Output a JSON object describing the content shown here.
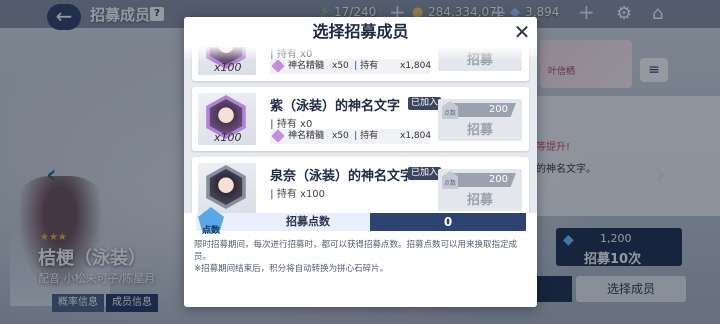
{
  "header": {
    "title": "招募成员",
    "info_badge": "?",
    "stamina": "17/240",
    "coins": "284,334,072",
    "gems": "3,894"
  },
  "background": {
    "char_name": "桔梗（泳装）",
    "char_cv": "配音 小松未可子/陈星月",
    "tabs": [
      "概率信息",
      "成员信息"
    ],
    "right_text_red": "等提升!",
    "right_text": "的神名文字。",
    "banner_text": "叶信栖",
    "recruit_cost": "1,200",
    "recruit_label": "招募10次",
    "select_member_label": "选择成员"
  },
  "modal": {
    "title": "选择招募成员",
    "close_label": "✕",
    "cards": [
      {
        "name": "",
        "joined_tag": "",
        "held_label": "持有",
        "held_value": "x0",
        "owned_qty": "x100",
        "material_name": "神名精髓",
        "material_mult": "x50",
        "material_held_label": "持有",
        "material_held_value": "x1,804",
        "points": "",
        "button_label": "招募"
      },
      {
        "name": "紫（泳装）的神名文字",
        "joined_tag": "已加入",
        "held_label": "持有",
        "held_value": "x0",
        "owned_qty": "x100",
        "material_name": "神名精髓",
        "material_mult": "x50",
        "material_held_label": "持有",
        "material_held_value": "x1,804",
        "points": "200",
        "points_badge": "点数",
        "button_label": "招募"
      },
      {
        "name": "泉奈（泳装）的神名文字",
        "joined_tag": "已加入",
        "held_label": "持有",
        "held_value": "x100",
        "owned_qty": "",
        "points": "200",
        "points_badge": "点数",
        "button_label": "招募"
      }
    ],
    "points_row": {
      "icon_label": "点数",
      "label": "招募点数",
      "value": "0"
    },
    "notes": [
      "限时招募期间，每次进行招募时，都可以获得招募点数。招募点数可以用来换取指定成员。",
      "※招募期间结束后，积分将自动转换为拼心石碎片。"
    ]
  }
}
